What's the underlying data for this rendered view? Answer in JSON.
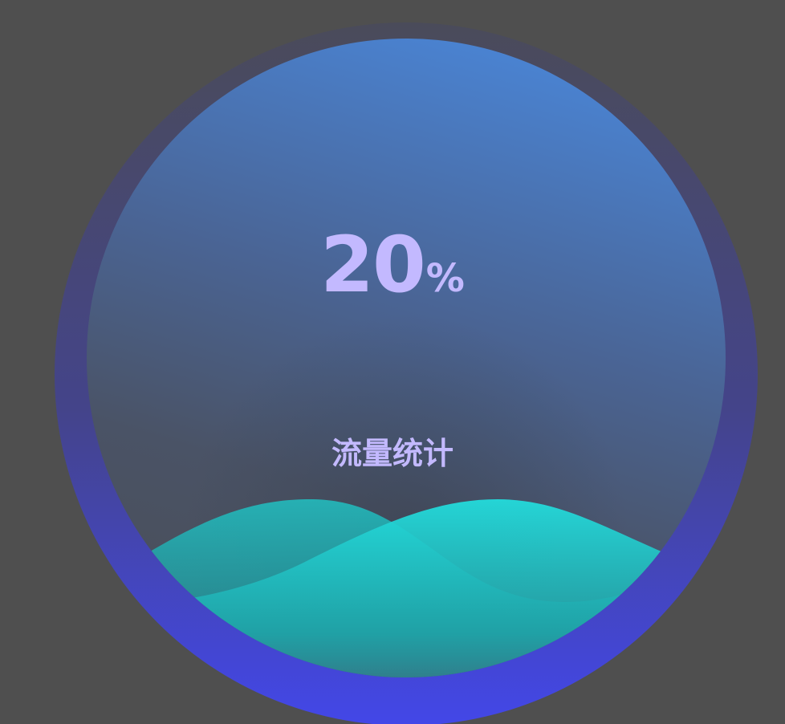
{
  "gauge": {
    "value": "20",
    "unit": "%",
    "fill_fraction": 0.2,
    "label": "流量统计"
  },
  "colors": {
    "background": "#4f4f4f",
    "ring_top": "#4a4e66",
    "ring_bottom": "#4347e6",
    "inner_top": "#4a84d6",
    "inner_bottom": "#4a5468",
    "wave_main": "#22e0e0",
    "wave_secondary": "#1fb8b8",
    "text": "#c3b9ff"
  },
  "icons": {
    "wave": "liquid-wave"
  }
}
